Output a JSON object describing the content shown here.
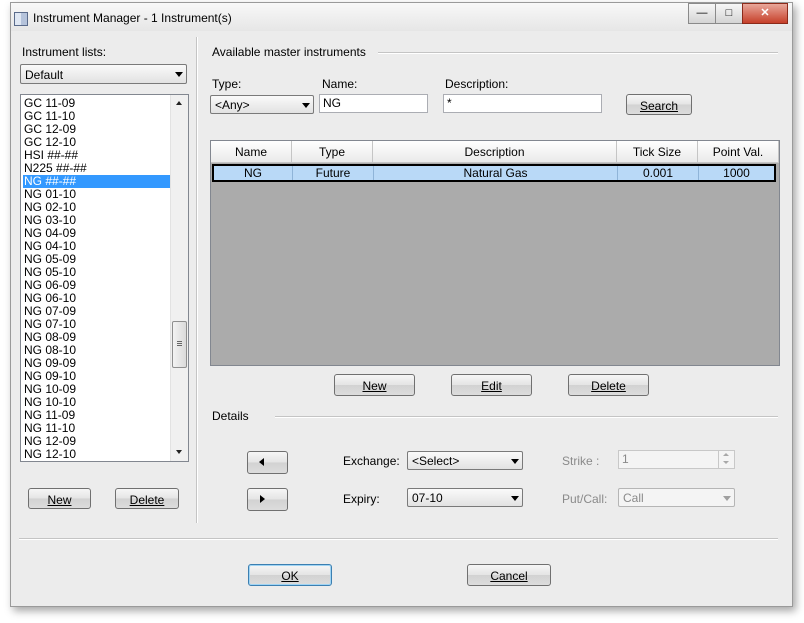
{
  "window": {
    "title": "Instrument Manager - 1 Instrument(s)",
    "caption_buttons": {
      "minimize": "—",
      "maximize": "□",
      "close": "✕"
    }
  },
  "left": {
    "lists_label": "Instrument lists:",
    "lists_combo": "Default",
    "items": [
      "GC 11-09",
      "GC 11-10",
      "GC 12-09",
      "GC 12-10",
      "HSI ##-##",
      "N225 ##-##",
      "NG ##-##",
      "NG 01-10",
      "NG 02-10",
      "NG 03-10",
      "NG 04-09",
      "NG 04-10",
      "NG 05-09",
      "NG 05-10",
      "NG 06-09",
      "NG 06-10",
      "NG 07-09",
      "NG 07-10",
      "NG 08-09",
      "NG 08-10",
      "NG 09-09",
      "NG 09-10",
      "NG 10-09",
      "NG 10-10",
      "NG 11-09",
      "NG 11-10",
      "NG 12-09",
      "NG 12-10"
    ],
    "selected_item": "NG ##-##",
    "new_button": "New",
    "delete_button": "Delete"
  },
  "master": {
    "group_label": "Available master instruments",
    "type_label": "Type:",
    "type_value": "<Any>",
    "name_label": "Name:",
    "name_value": "NG",
    "description_label": "Description:",
    "description_value": "*",
    "search_button": "Search",
    "columns": [
      "Name",
      "Type",
      "Description",
      "Tick Size",
      "Point Val."
    ],
    "rows": [
      [
        "NG",
        "Future",
        "Natural Gas",
        "0.001",
        "1000"
      ]
    ],
    "new_button": "New",
    "edit_button": "Edit",
    "delete_button": "Delete"
  },
  "details": {
    "group_label": "Details",
    "exchange_label": "Exchange:",
    "exchange_value": "<Select>",
    "expiry_label": "Expiry:",
    "expiry_value": "07-10",
    "strike_label": "Strike :",
    "strike_value": "1",
    "putcall_label": "Put/Call:",
    "putcall_value": "Call"
  },
  "footer": {
    "ok_button": "OK",
    "cancel_button": "Cancel"
  },
  "colors": {
    "selection": "#3399ff",
    "grid_background": "#ababab",
    "grid_row": "#b9d9f7",
    "window_background": "#ececec"
  }
}
